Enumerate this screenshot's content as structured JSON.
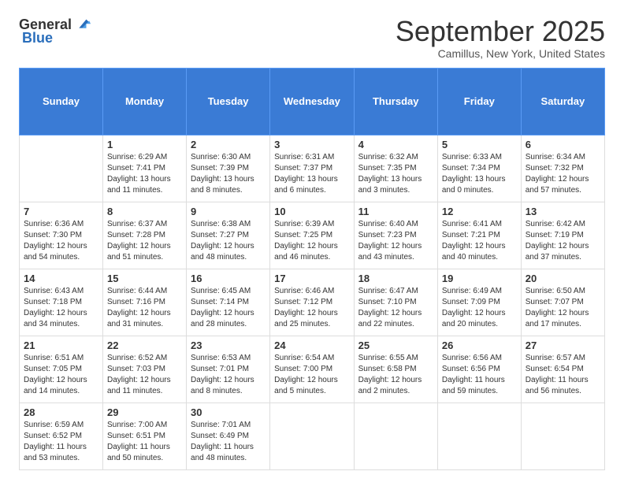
{
  "logo": {
    "general": "General",
    "blue": "Blue"
  },
  "title": "September 2025",
  "location": "Camillus, New York, United States",
  "weekdays": [
    "Sunday",
    "Monday",
    "Tuesday",
    "Wednesday",
    "Thursday",
    "Friday",
    "Saturday"
  ],
  "weeks": [
    [
      {
        "day": "",
        "sunrise": "",
        "sunset": "",
        "daylight": ""
      },
      {
        "day": "1",
        "sunrise": "Sunrise: 6:29 AM",
        "sunset": "Sunset: 7:41 PM",
        "daylight": "Daylight: 13 hours and 11 minutes."
      },
      {
        "day": "2",
        "sunrise": "Sunrise: 6:30 AM",
        "sunset": "Sunset: 7:39 PM",
        "daylight": "Daylight: 13 hours and 8 minutes."
      },
      {
        "day": "3",
        "sunrise": "Sunrise: 6:31 AM",
        "sunset": "Sunset: 7:37 PM",
        "daylight": "Daylight: 13 hours and 6 minutes."
      },
      {
        "day": "4",
        "sunrise": "Sunrise: 6:32 AM",
        "sunset": "Sunset: 7:35 PM",
        "daylight": "Daylight: 13 hours and 3 minutes."
      },
      {
        "day": "5",
        "sunrise": "Sunrise: 6:33 AM",
        "sunset": "Sunset: 7:34 PM",
        "daylight": "Daylight: 13 hours and 0 minutes."
      },
      {
        "day": "6",
        "sunrise": "Sunrise: 6:34 AM",
        "sunset": "Sunset: 7:32 PM",
        "daylight": "Daylight: 12 hours and 57 minutes."
      }
    ],
    [
      {
        "day": "7",
        "sunrise": "Sunrise: 6:36 AM",
        "sunset": "Sunset: 7:30 PM",
        "daylight": "Daylight: 12 hours and 54 minutes."
      },
      {
        "day": "8",
        "sunrise": "Sunrise: 6:37 AM",
        "sunset": "Sunset: 7:28 PM",
        "daylight": "Daylight: 12 hours and 51 minutes."
      },
      {
        "day": "9",
        "sunrise": "Sunrise: 6:38 AM",
        "sunset": "Sunset: 7:27 PM",
        "daylight": "Daylight: 12 hours and 48 minutes."
      },
      {
        "day": "10",
        "sunrise": "Sunrise: 6:39 AM",
        "sunset": "Sunset: 7:25 PM",
        "daylight": "Daylight: 12 hours and 46 minutes."
      },
      {
        "day": "11",
        "sunrise": "Sunrise: 6:40 AM",
        "sunset": "Sunset: 7:23 PM",
        "daylight": "Daylight: 12 hours and 43 minutes."
      },
      {
        "day": "12",
        "sunrise": "Sunrise: 6:41 AM",
        "sunset": "Sunset: 7:21 PM",
        "daylight": "Daylight: 12 hours and 40 minutes."
      },
      {
        "day": "13",
        "sunrise": "Sunrise: 6:42 AM",
        "sunset": "Sunset: 7:19 PM",
        "daylight": "Daylight: 12 hours and 37 minutes."
      }
    ],
    [
      {
        "day": "14",
        "sunrise": "Sunrise: 6:43 AM",
        "sunset": "Sunset: 7:18 PM",
        "daylight": "Daylight: 12 hours and 34 minutes."
      },
      {
        "day": "15",
        "sunrise": "Sunrise: 6:44 AM",
        "sunset": "Sunset: 7:16 PM",
        "daylight": "Daylight: 12 hours and 31 minutes."
      },
      {
        "day": "16",
        "sunrise": "Sunrise: 6:45 AM",
        "sunset": "Sunset: 7:14 PM",
        "daylight": "Daylight: 12 hours and 28 minutes."
      },
      {
        "day": "17",
        "sunrise": "Sunrise: 6:46 AM",
        "sunset": "Sunset: 7:12 PM",
        "daylight": "Daylight: 12 hours and 25 minutes."
      },
      {
        "day": "18",
        "sunrise": "Sunrise: 6:47 AM",
        "sunset": "Sunset: 7:10 PM",
        "daylight": "Daylight: 12 hours and 22 minutes."
      },
      {
        "day": "19",
        "sunrise": "Sunrise: 6:49 AM",
        "sunset": "Sunset: 7:09 PM",
        "daylight": "Daylight: 12 hours and 20 minutes."
      },
      {
        "day": "20",
        "sunrise": "Sunrise: 6:50 AM",
        "sunset": "Sunset: 7:07 PM",
        "daylight": "Daylight: 12 hours and 17 minutes."
      }
    ],
    [
      {
        "day": "21",
        "sunrise": "Sunrise: 6:51 AM",
        "sunset": "Sunset: 7:05 PM",
        "daylight": "Daylight: 12 hours and 14 minutes."
      },
      {
        "day": "22",
        "sunrise": "Sunrise: 6:52 AM",
        "sunset": "Sunset: 7:03 PM",
        "daylight": "Daylight: 12 hours and 11 minutes."
      },
      {
        "day": "23",
        "sunrise": "Sunrise: 6:53 AM",
        "sunset": "Sunset: 7:01 PM",
        "daylight": "Daylight: 12 hours and 8 minutes."
      },
      {
        "day": "24",
        "sunrise": "Sunrise: 6:54 AM",
        "sunset": "Sunset: 7:00 PM",
        "daylight": "Daylight: 12 hours and 5 minutes."
      },
      {
        "day": "25",
        "sunrise": "Sunrise: 6:55 AM",
        "sunset": "Sunset: 6:58 PM",
        "daylight": "Daylight: 12 hours and 2 minutes."
      },
      {
        "day": "26",
        "sunrise": "Sunrise: 6:56 AM",
        "sunset": "Sunset: 6:56 PM",
        "daylight": "Daylight: 11 hours and 59 minutes."
      },
      {
        "day": "27",
        "sunrise": "Sunrise: 6:57 AM",
        "sunset": "Sunset: 6:54 PM",
        "daylight": "Daylight: 11 hours and 56 minutes."
      }
    ],
    [
      {
        "day": "28",
        "sunrise": "Sunrise: 6:59 AM",
        "sunset": "Sunset: 6:52 PM",
        "daylight": "Daylight: 11 hours and 53 minutes."
      },
      {
        "day": "29",
        "sunrise": "Sunrise: 7:00 AM",
        "sunset": "Sunset: 6:51 PM",
        "daylight": "Daylight: 11 hours and 50 minutes."
      },
      {
        "day": "30",
        "sunrise": "Sunrise: 7:01 AM",
        "sunset": "Sunset: 6:49 PM",
        "daylight": "Daylight: 11 hours and 48 minutes."
      },
      {
        "day": "",
        "sunrise": "",
        "sunset": "",
        "daylight": ""
      },
      {
        "day": "",
        "sunrise": "",
        "sunset": "",
        "daylight": ""
      },
      {
        "day": "",
        "sunrise": "",
        "sunset": "",
        "daylight": ""
      },
      {
        "day": "",
        "sunrise": "",
        "sunset": "",
        "daylight": ""
      }
    ]
  ]
}
